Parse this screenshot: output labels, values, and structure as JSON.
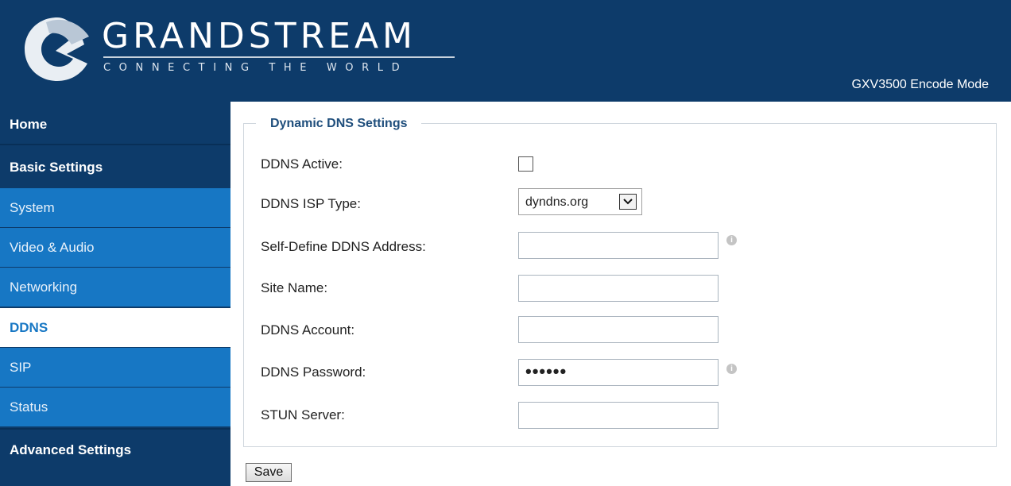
{
  "header": {
    "brand": "GRANDSTREAM",
    "tagline": "CONNECTING THE WORLD",
    "mode": "GXV3500 Encode Mode"
  },
  "sidebar": {
    "items": [
      {
        "label": "Home",
        "kind": "section"
      },
      {
        "label": "Basic Settings",
        "kind": "section"
      },
      {
        "label": "System",
        "kind": "sub"
      },
      {
        "label": "Video & Audio",
        "kind": "sub"
      },
      {
        "label": "Networking",
        "kind": "sub"
      },
      {
        "label": "DDNS",
        "kind": "active"
      },
      {
        "label": "SIP",
        "kind": "sub"
      },
      {
        "label": "Status",
        "kind": "sub"
      },
      {
        "label": "Advanced Settings",
        "kind": "section"
      }
    ]
  },
  "form": {
    "legend": "Dynamic DNS Settings",
    "fields": {
      "ddns_active": {
        "label": "DDNS Active:",
        "checked": false
      },
      "isp_type": {
        "label": "DDNS ISP Type:",
        "value": "dyndns.org"
      },
      "self_define": {
        "label": "Self-Define DDNS Address:",
        "value": ""
      },
      "site_name": {
        "label": "Site Name:",
        "value": ""
      },
      "account": {
        "label": "DDNS Account:",
        "value": ""
      },
      "password": {
        "label": "DDNS Password:",
        "value": "••••••"
      },
      "stun": {
        "label": "STUN Server:",
        "value": ""
      }
    },
    "info_icon": "i",
    "save_label": "Save"
  },
  "colors": {
    "header_bg": "#0d3b6a",
    "sub_nav_bg": "#1777c4",
    "accent": "#1777c4",
    "legend_text": "#1f4e7c"
  }
}
